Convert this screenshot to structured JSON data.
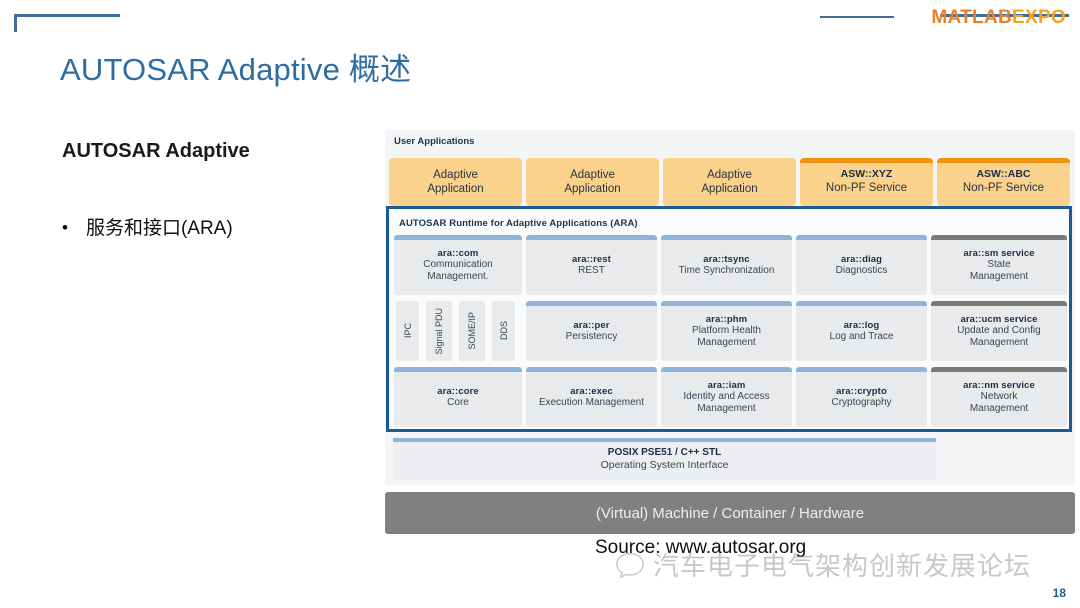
{
  "brand": {
    "part1": "MATLAB",
    "part2": "EXPO",
    "rule_color": "#3f6f99"
  },
  "slide": {
    "title": "AUTOSAR Adaptive 概述",
    "title_color": "#2e6da4",
    "page_number": "18"
  },
  "left": {
    "lead": "AUTOSAR Adaptive",
    "bullet_marker": "•",
    "bullet": "服务和接口(ARA)"
  },
  "diagram": {
    "user_applications_label": "User Applications",
    "ara_header": "AUTOSAR Runtime for Adaptive Applications  (ARA)",
    "colors": {
      "app_fill": "#fad28c",
      "app_cap": "#f0920f",
      "module_fill": "#e9eaec",
      "cap_blue": "#8fb4da",
      "cap_gray": "#7c7a74",
      "ara_border": "#1d5b8f",
      "hardware_fill": "#808080",
      "panel_bg": "#f4f5f7"
    },
    "applications": [
      {
        "line1": "Adaptive",
        "line2": "Application",
        "kind": "adaptive"
      },
      {
        "line1": "Adaptive",
        "line2": "Application",
        "kind": "adaptive"
      },
      {
        "line1": "Adaptive",
        "line2": "Application",
        "kind": "adaptive"
      },
      {
        "line1": "ASW::XYZ",
        "line2": "Non-PF Service",
        "kind": "asw"
      },
      {
        "line1": "ASW::ABC",
        "line2": "Non-PF Service",
        "kind": "asw"
      }
    ],
    "protocol_chips": [
      {
        "label": "IPC"
      },
      {
        "label": "Signal PDU"
      },
      {
        "label": "SOME/IP"
      },
      {
        "label": "DDS"
      }
    ],
    "modules_row1": [
      {
        "title": "ara::com",
        "subtitle": "Communication\nManagement.",
        "cap": "blue"
      },
      {
        "title": "ara::rest",
        "subtitle": "REST",
        "cap": "blue"
      },
      {
        "title": "ara::tsync",
        "subtitle": "Time Synchronization",
        "cap": "blue"
      },
      {
        "title": "ara::diag",
        "subtitle": "Diagnostics",
        "cap": "blue"
      },
      {
        "title": "ara::sm service",
        "subtitle": "State\nManagement",
        "cap": "gray"
      }
    ],
    "modules_row2": [
      {
        "title": "ara::per",
        "subtitle": "Persistency",
        "cap": "blue"
      },
      {
        "title": "ara::phm",
        "subtitle": "Platform Health\nManagement",
        "cap": "blue"
      },
      {
        "title": "ara::log",
        "subtitle": "Log and Trace",
        "cap": "blue"
      },
      {
        "title": "ara::ucm service",
        "subtitle": "Update and Config\nManagement",
        "cap": "gray"
      }
    ],
    "modules_row3": [
      {
        "title": "ara::core",
        "subtitle": "Core",
        "cap": "blue"
      },
      {
        "title": "ara::exec",
        "subtitle": "Execution Management",
        "cap": "blue"
      },
      {
        "title": "ara::iam",
        "subtitle": "Identity and Access\nManagement",
        "cap": "blue"
      },
      {
        "title": "ara::crypto",
        "subtitle": "Cryptography",
        "cap": "blue"
      },
      {
        "title": "ara::nm service",
        "subtitle": "Network\nManagement",
        "cap": "gray"
      }
    ],
    "os_layer": {
      "line1": "POSIX PSE51 / C++ STL",
      "line2": "Operating System Interface"
    },
    "hardware_layer": "(Virtual) Machine / Container / Hardware"
  },
  "footer": {
    "source": "Source: www.autosar.org",
    "watermark": "汽车电子电气架构创新发展论坛"
  }
}
